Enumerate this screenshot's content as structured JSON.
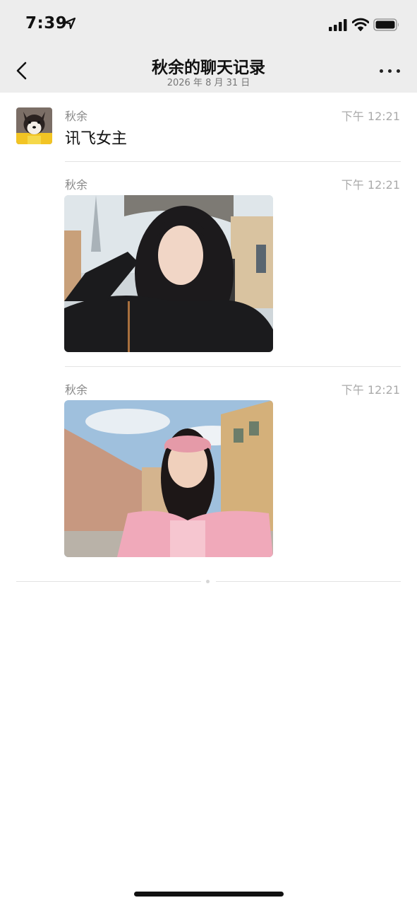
{
  "status_bar": {
    "time": "7:39"
  },
  "nav": {
    "title": "秋余的聊天记录",
    "subtitle": "2026 年 8 月 31 日"
  },
  "messages": [
    {
      "sender": "秋余",
      "time": "下午 12:21",
      "type": "text",
      "text": "讯飞女主"
    },
    {
      "sender": "秋余",
      "time": "下午 12:21",
      "type": "image"
    },
    {
      "sender": "秋余",
      "time": "下午 12:21",
      "type": "image"
    }
  ],
  "colors": {
    "bar_bg": "#ededed",
    "divider": "#e3e3e3",
    "meta_text": "#888888"
  }
}
